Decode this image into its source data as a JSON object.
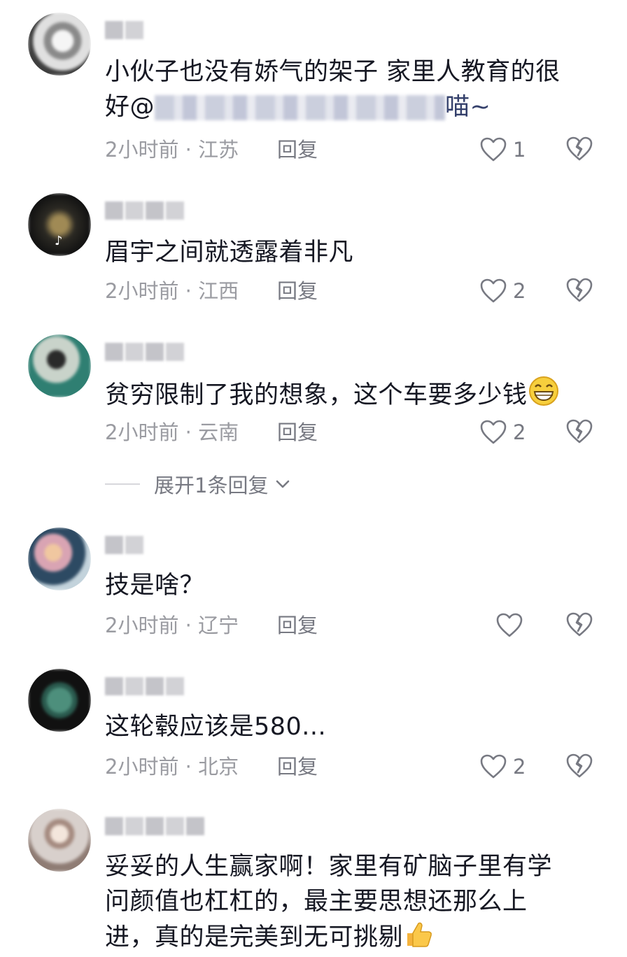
{
  "comments": [
    {
      "text_before": "小伙子也没有娇气的架子 家里人教育的很\n好@",
      "text_after": "喵~",
      "time_location": "2小时前 · 江苏",
      "reply": "回复",
      "likes": "1",
      "avatar_colors": [
        "#e7e7e7",
        "#5a5a5a"
      ]
    },
    {
      "text": "眉宇之间就透露着非凡",
      "time_location": "2小时前 · 江西",
      "reply": "回复",
      "likes": "2",
      "avatar_colors": [
        "#1c1c1c",
        "#7d6a40"
      ]
    },
    {
      "text": "贫穷限制了我的想象，这个车要多少钱",
      "time_location": "2小时前 · 云南",
      "reply": "回复",
      "likes": "2",
      "avatar_colors": [
        "#c8d2c9",
        "#2f7f72"
      ]
    },
    {
      "text": "技是啥？",
      "time_location": "2小时前 · 辽宁",
      "reply": "回复",
      "likes": "",
      "avatar_colors": [
        "#d9a4b3",
        "#2d4a63"
      ]
    },
    {
      "text": "这轮毂应该是580...",
      "time_location": "2小时前 · 北京",
      "reply": "回复",
      "likes": "2",
      "avatar_colors": [
        "#1a1a1a",
        "#3c7b6a"
      ]
    },
    {
      "text": "妥妥的人生赢家啊！家里有矿脑子里有学\n问颜值也杠杠的，最主要思想还那么上\n进，真的是完美到无可挑剔",
      "avatar_colors": [
        "#d8d0cc",
        "#8f7c74"
      ]
    }
  ],
  "expand_replies": "展开1条回复",
  "colors": {
    "text": "#161823",
    "meta": "#9a9ba1",
    "secondary": "#777982"
  }
}
